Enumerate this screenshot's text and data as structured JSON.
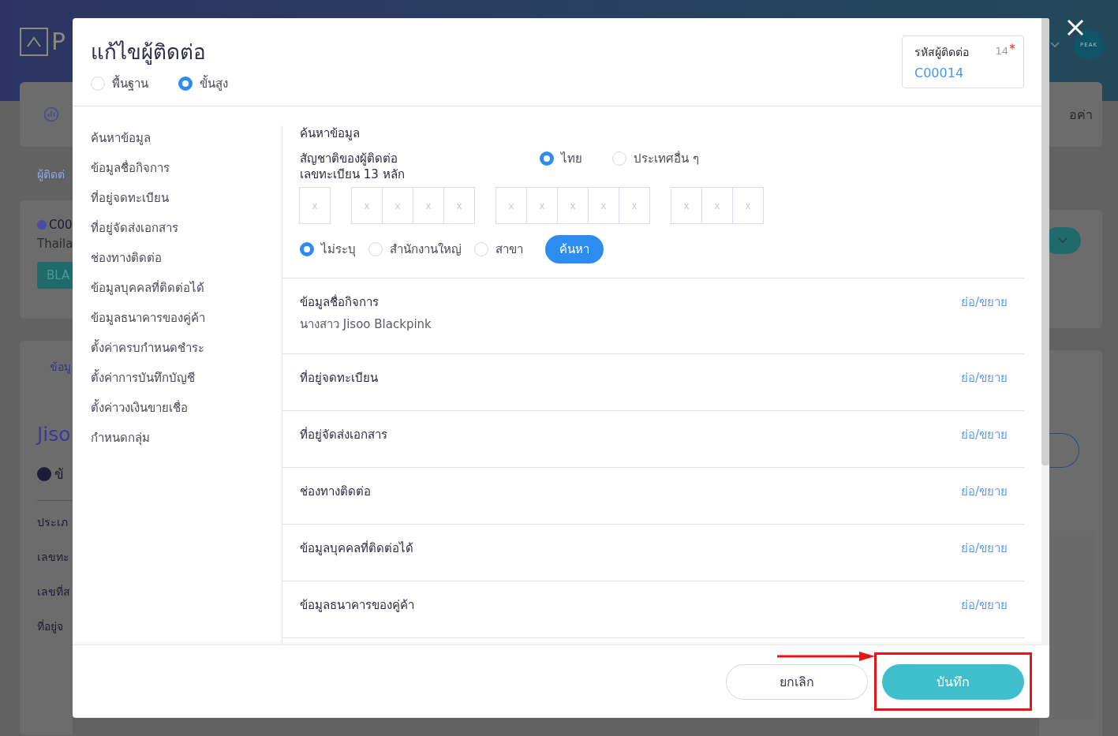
{
  "background_page": {
    "logo_text": "P",
    "breadcrumb": "ผู้ติดต่",
    "contact_card": {
      "code": "C00",
      "country": "Thaila",
      "tag": "BLA"
    },
    "tab": "ข้อมู",
    "name": "Jiso",
    "section": "ข้",
    "fields": [
      "ประเภ",
      "เลขทะ",
      "เลขที่ส",
      "ที่อยู่จ"
    ],
    "right_tab": "อค่า",
    "avatar": "PEAK"
  },
  "dialog": {
    "title": "แก้ไขผู้ติดต่อ",
    "modes": [
      {
        "label": "พื้นฐาน",
        "selected": false
      },
      {
        "label": "ขั้นสูง",
        "selected": true
      }
    ],
    "contact_code": {
      "label": "รหัสผู้ติดต่อ",
      "count": "14",
      "required": true,
      "value": "C00014"
    },
    "nav": [
      "ค้นหาข้อมูล",
      "ข้อมูลชื่อกิจการ",
      "ที่อยู่จดทะเบียน",
      "ที่อยู่จัดส่งเอกสาร",
      "ช่องทางติดต่อ",
      "ข้อมูลบุคคลที่ติดต่อได้",
      "ข้อมูลธนาคารของคู่ค้า",
      "ตั้งค่าครบกำหนดชำระ",
      "ตั้งค่าการบันทึกบัญชี",
      "ตั้งค่าวงเงินขายเชื่อ",
      "กำหนดกลุ่ม"
    ],
    "search": {
      "heading": "ค้นหาข้อมูล",
      "nationality_label": "สัญชาติของผู้ติดต่อ",
      "nationality": [
        {
          "label": "ไทย",
          "selected": true
        },
        {
          "label": "ประเทศอื่น ๆ",
          "selected": false
        }
      ],
      "id_label": "เลขทะเบียน 13 หลัก",
      "id_groups": [
        [
          {
            "placeholder": "x"
          }
        ],
        [
          {
            "placeholder": "x"
          },
          {
            "placeholder": "x"
          },
          {
            "placeholder": "x"
          },
          {
            "placeholder": "x"
          }
        ],
        [
          {
            "placeholder": "x"
          },
          {
            "placeholder": "x"
          },
          {
            "placeholder": "x"
          },
          {
            "placeholder": "x"
          },
          {
            "placeholder": "x"
          }
        ],
        [
          {
            "placeholder": "x"
          },
          {
            "placeholder": "x"
          },
          {
            "placeholder": "x"
          }
        ]
      ],
      "branch": [
        {
          "label": "ไม่ระบุ",
          "selected": true
        },
        {
          "label": "สำนักงานใหญ่",
          "selected": false
        },
        {
          "label": "สาขา",
          "selected": false
        }
      ],
      "button": "ค้นหา"
    },
    "sections": [
      {
        "title": "ข้อมูลชื่อกิจการ",
        "value": "นางสาว Jisoo Blackpink",
        "toggle": "ย่อ/ขยาย"
      },
      {
        "title": "ที่อยู่จดทะเบียน",
        "toggle": "ย่อ/ขยาย"
      },
      {
        "title": "ที่อยู่จัดส่งเอกสาร",
        "toggle": "ย่อ/ขยาย"
      },
      {
        "title": "ช่องทางติดต่อ",
        "toggle": "ย่อ/ขยาย"
      },
      {
        "title": "ข้อมูลบุคคลที่ติดต่อได้",
        "toggle": "ย่อ/ขยาย"
      },
      {
        "title": "ข้อมูลธนาคารของคู่ค้า",
        "toggle": "ย่อ/ขยาย"
      }
    ],
    "buttons": {
      "cancel": "ยกเลิก",
      "save": "บันทึก"
    }
  }
}
